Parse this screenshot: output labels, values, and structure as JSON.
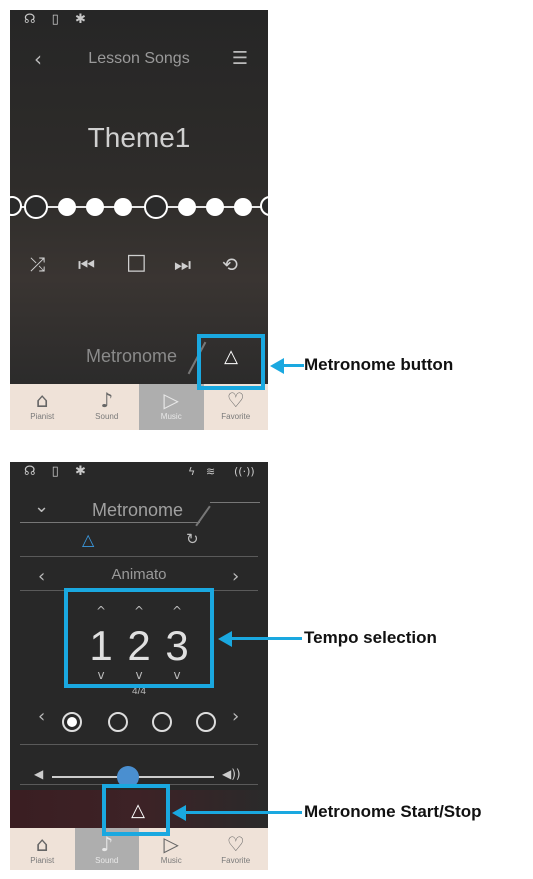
{
  "screen1": {
    "status_icons": "☊ ▯ ✱",
    "header": {
      "back": "‹",
      "title": "Lesson Songs",
      "list_icon": "☰"
    },
    "song_title": "Theme1",
    "controls": [
      "⤮",
      "⏮",
      "□",
      "⏭",
      "⟲"
    ],
    "metronome_label": "Metronome",
    "metronome_icon": "△"
  },
  "screen2": {
    "status_icons": "☊ ▯ ✱",
    "status_right": [
      "ϟ",
      "≋",
      "((·))"
    ],
    "header": {
      "collapse": "⌄",
      "title": "Metronome"
    },
    "tabs": {
      "metronome_icon": "△",
      "rhythm_icon": "↻"
    },
    "tempo_name": "Animato",
    "prev": "‹",
    "next": "›",
    "tempo_digits": [
      "1",
      "2",
      "3"
    ],
    "time_signature": "4/4",
    "volume": {
      "low_icon": "◀",
      "high_icon": "◀))",
      "level": 0.47
    },
    "start_stop_icon": "△"
  },
  "nav": [
    {
      "label": "Pianist",
      "icon": "⌂"
    },
    {
      "label": "Sound",
      "icon": "♪"
    },
    {
      "label": "Music",
      "icon": "▷"
    },
    {
      "label": "Favorite",
      "icon": "♡"
    }
  ],
  "callouts": {
    "metronome_button": "Metronome button",
    "tempo_selection": "Tempo selection",
    "start_stop": "Metronome Start/Stop"
  },
  "colors": {
    "highlight": "#1aa8e0",
    "accent_blue": "#3b9ae0"
  }
}
